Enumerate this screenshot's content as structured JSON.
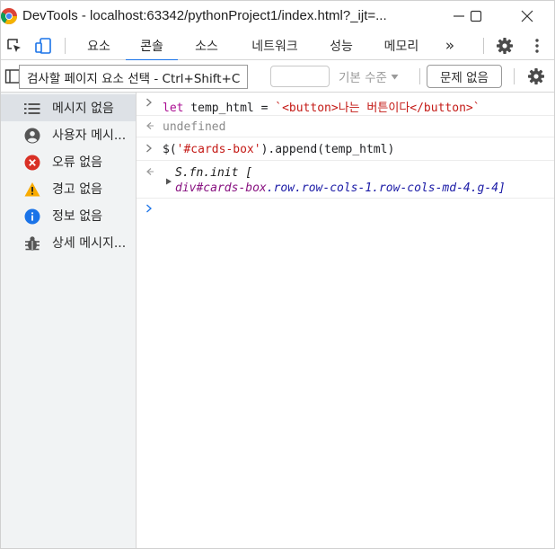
{
  "window": {
    "title": "DevTools - localhost:63342/pythonProject1/index.html?_ijt=...",
    "minimize_icon": "minimize-icon",
    "maximize_icon": "maximize-icon",
    "close_icon": "close-icon"
  },
  "tabs": [
    {
      "label": "요소"
    },
    {
      "label": "콘솔"
    },
    {
      "label": "소스"
    },
    {
      "label": "네트워크"
    },
    {
      "label": "성능"
    },
    {
      "label": "메모리"
    },
    {
      "label": "»"
    }
  ],
  "active_tab": "콘솔",
  "toolbar": {
    "tooltip": "검사할 페이지 요소 선택 - Ctrl+Shift+C",
    "levels_label": "기본 수준",
    "issues_label": "문제 없음"
  },
  "sidebar": {
    "items": [
      {
        "label": "메시지 없음",
        "icon": "list-icon"
      },
      {
        "label": "사용자 메시...",
        "icon": "user-icon"
      },
      {
        "label": "오류 없음",
        "icon": "error-icon"
      },
      {
        "label": "경고 없음",
        "icon": "warning-icon"
      },
      {
        "label": "정보 없음",
        "icon": "info-icon"
      },
      {
        "label": "상세 메시지...",
        "icon": "bug-icon"
      }
    ]
  },
  "console": {
    "line1_prefix": "let",
    "line1_mid": " temp_html = ",
    "line1_str_a": "`",
    "line1_tag_open": "<button>",
    "line1_text": "나는 버튼이다",
    "line1_tag_close": "</button>",
    "line1_str_b": "`",
    "line2_result": "undefined",
    "line3_a": "$(",
    "line3_str": "'#cards-box'",
    "line3_b": ").append(temp_html)",
    "line4_a": "S.fn.init [",
    "line4_b": "div#cards-box",
    "line4_c": ".row.row-cols-1.row-cols-md-4.g-4]"
  },
  "colors": {
    "accent": "#1a73e8",
    "error": "#d93025",
    "warning": "#f9ab00",
    "info": "#1a73e8"
  }
}
